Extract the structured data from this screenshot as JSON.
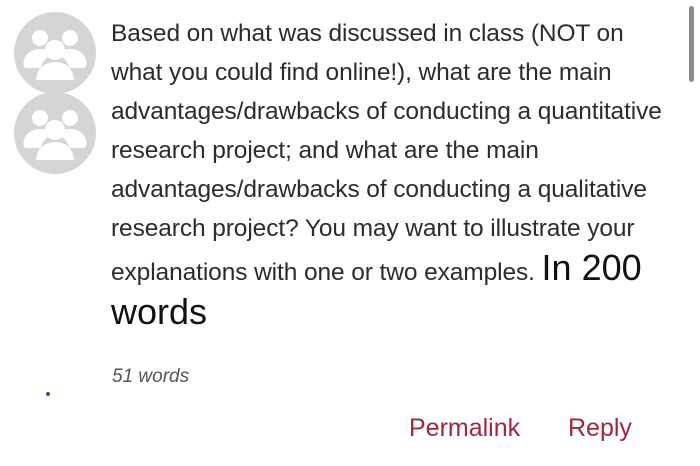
{
  "post": {
    "body_text": "Based on what was discussed in class (NOT on what you could find online!), what are the main advantages/drawbacks of conducting a quantitative research project; and what are the main advantages/drawbacks of conducting a qualitative research project? You may want to illustrate your explanations with one or two examples.",
    "emphasis_text": "In 200 words",
    "word_count": "51 words"
  },
  "actions": {
    "permalink_label": "Permalink",
    "reply_label": "Reply"
  },
  "icons": {
    "avatar": "group-avatar-icon"
  },
  "colors": {
    "link": "#a3263f",
    "avatar_bg": "#d5d5d5"
  }
}
